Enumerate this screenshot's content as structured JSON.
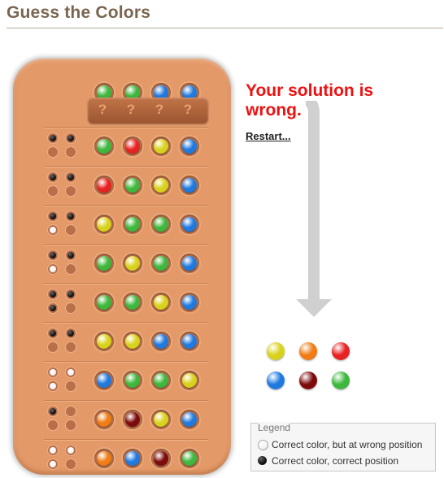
{
  "page": {
    "title": "Guess the Colors"
  },
  "colors": {
    "green": "#3db83d",
    "blue": "#1f7ae0",
    "yellow": "#d9d21d",
    "red": "#e82222",
    "orange": "#f07d15",
    "darkred": "#7d0b0b",
    "key_black": "#111111",
    "key_white": "#f4f4f4"
  },
  "board": {
    "solution": [
      "green",
      "green",
      "blue",
      "blue"
    ],
    "hidden_marks": [
      "?",
      "?",
      "?",
      "?"
    ],
    "rows": [
      {
        "guess": [
          "green",
          "red",
          "yellow",
          "blue"
        ],
        "keys": [
          "black",
          "black",
          "empty",
          "empty"
        ]
      },
      {
        "guess": [
          "red",
          "green",
          "yellow",
          "blue"
        ],
        "keys": [
          "black",
          "black",
          "empty",
          "empty"
        ]
      },
      {
        "guess": [
          "yellow",
          "green",
          "green",
          "blue"
        ],
        "keys": [
          "black",
          "black",
          "white",
          "empty"
        ]
      },
      {
        "guess": [
          "green",
          "yellow",
          "green",
          "blue"
        ],
        "keys": [
          "black",
          "black",
          "white",
          "empty"
        ]
      },
      {
        "guess": [
          "green",
          "green",
          "yellow",
          "blue"
        ],
        "keys": [
          "black",
          "black",
          "black",
          "empty"
        ]
      },
      {
        "guess": [
          "yellow",
          "yellow",
          "blue",
          "blue"
        ],
        "keys": [
          "black",
          "black",
          "empty",
          "empty"
        ]
      },
      {
        "guess": [
          "blue",
          "green",
          "green",
          "yellow"
        ],
        "keys": [
          "white",
          "white",
          "white",
          "empty"
        ]
      },
      {
        "guess": [
          "orange",
          "darkred",
          "yellow",
          "blue"
        ],
        "keys": [
          "black",
          "empty",
          "empty",
          "empty"
        ]
      },
      {
        "guess": [
          "orange",
          "blue",
          "darkred",
          "green"
        ],
        "keys": [
          "white",
          "white",
          "white",
          "empty"
        ]
      }
    ]
  },
  "status": {
    "message": "Your solution is wrong.",
    "restart_label": "Restart..."
  },
  "palette": [
    "yellow",
    "orange",
    "red",
    "blue",
    "darkred",
    "green"
  ],
  "legend": {
    "title": "Legend",
    "items": [
      {
        "key": "white",
        "label": "Correct color, but at wrong position"
      },
      {
        "key": "black",
        "label": "Correct color, correct position"
      }
    ]
  }
}
